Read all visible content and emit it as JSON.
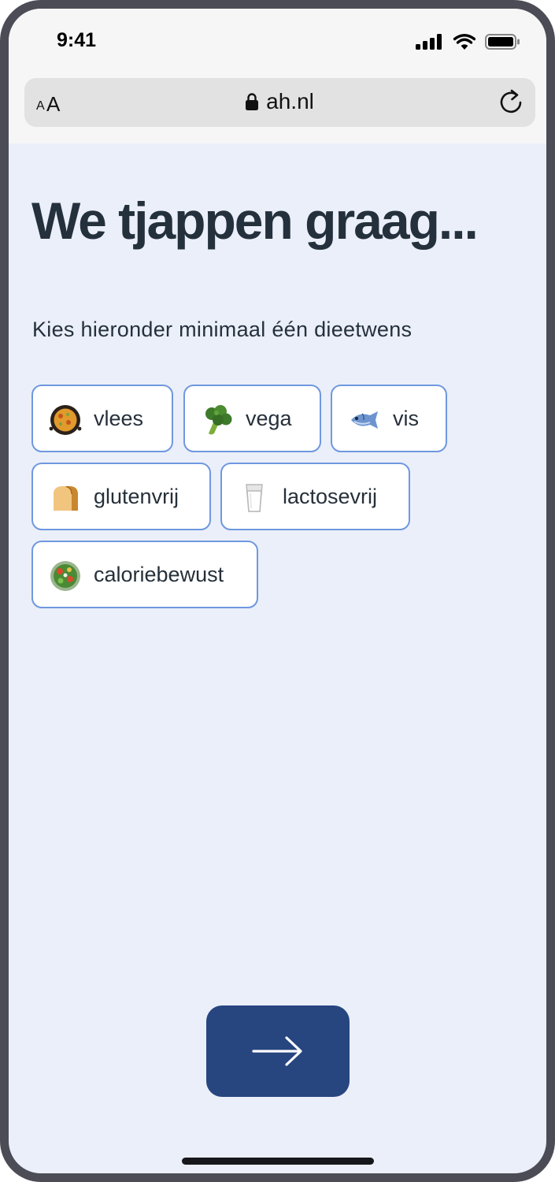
{
  "status_bar": {
    "time": "9:41"
  },
  "browser": {
    "text_size_small": "A",
    "text_size_large": "A",
    "url": "ah.nl"
  },
  "page": {
    "title": "We tjappen graag...",
    "subtitle": "Kies hieronder minimaal één dieetwens"
  },
  "options": [
    {
      "label": "vlees",
      "icon": "paella-icon"
    },
    {
      "label": "vega",
      "icon": "broccoli-icon"
    },
    {
      "label": "vis",
      "icon": "fish-icon"
    },
    {
      "label": "glutenvrij",
      "icon": "bread-icon"
    },
    {
      "label": "lactosevrij",
      "icon": "milk-glass-icon"
    },
    {
      "label": "caloriebewust",
      "icon": "salad-icon"
    }
  ],
  "next_button": {
    "icon": "arrow-right-icon"
  },
  "colors": {
    "background": "#ebeff9",
    "heading": "#24313d",
    "chip_border": "#6f98e0",
    "primary_button": "#274680"
  }
}
